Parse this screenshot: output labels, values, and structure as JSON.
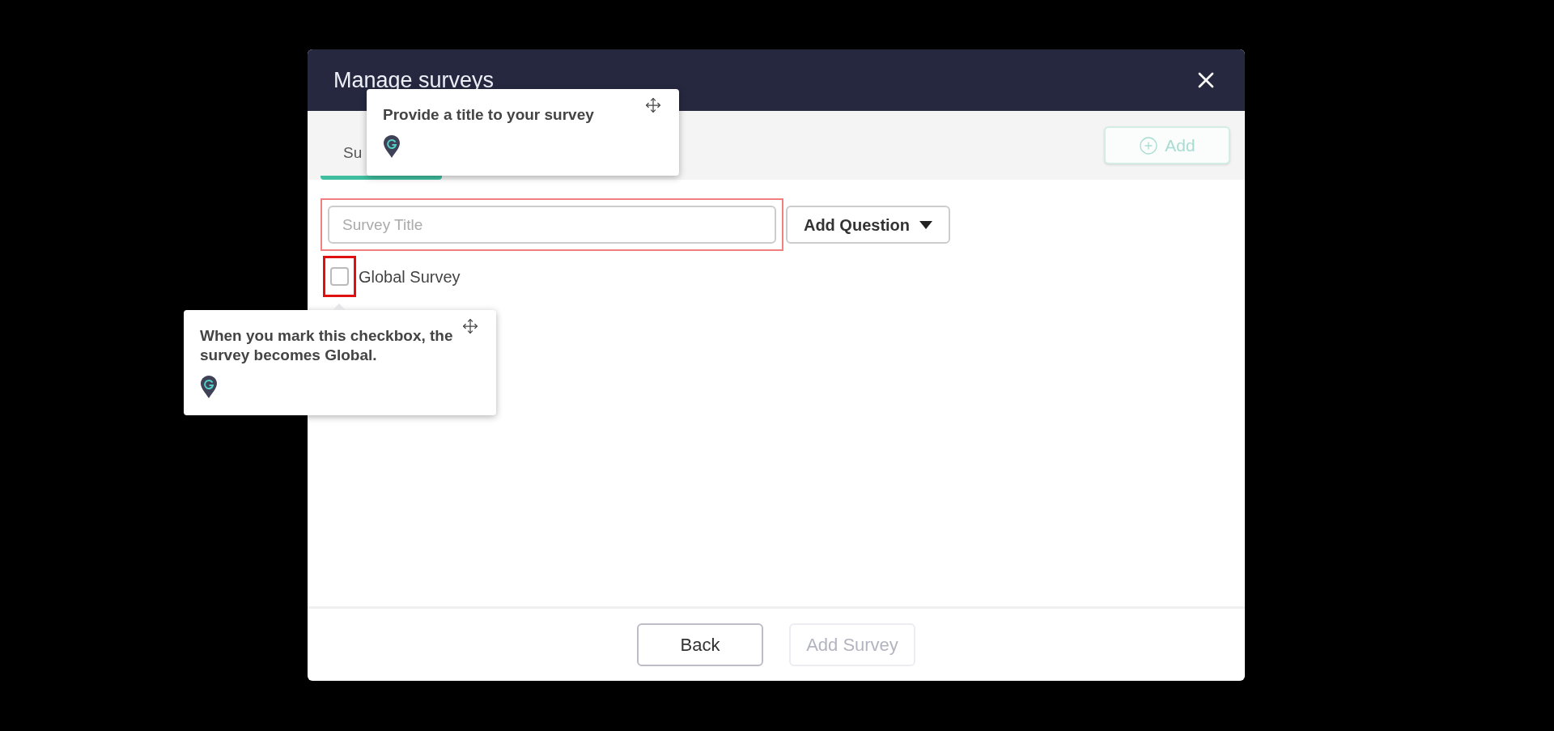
{
  "dialog": {
    "title": "Manage surveys"
  },
  "tabs": [
    {
      "label": "Su",
      "selected": true
    }
  ],
  "add_button": {
    "label": "Add",
    "disabled": true
  },
  "survey_title": {
    "placeholder": "Survey Title",
    "highlighted": true
  },
  "add_question": {
    "label": "Add Question"
  },
  "global_survey": {
    "label": "Global Survey",
    "checked": false,
    "highlighted": true
  },
  "tooltips": [
    {
      "text": "Provide a title to your survey"
    },
    {
      "text": "When you mark this checkbox, the survey becomes Global."
    }
  ],
  "footer_buttons": [
    {
      "label": "Back",
      "disabled": false
    },
    {
      "label": "Add Survey",
      "disabled": true
    }
  ]
}
